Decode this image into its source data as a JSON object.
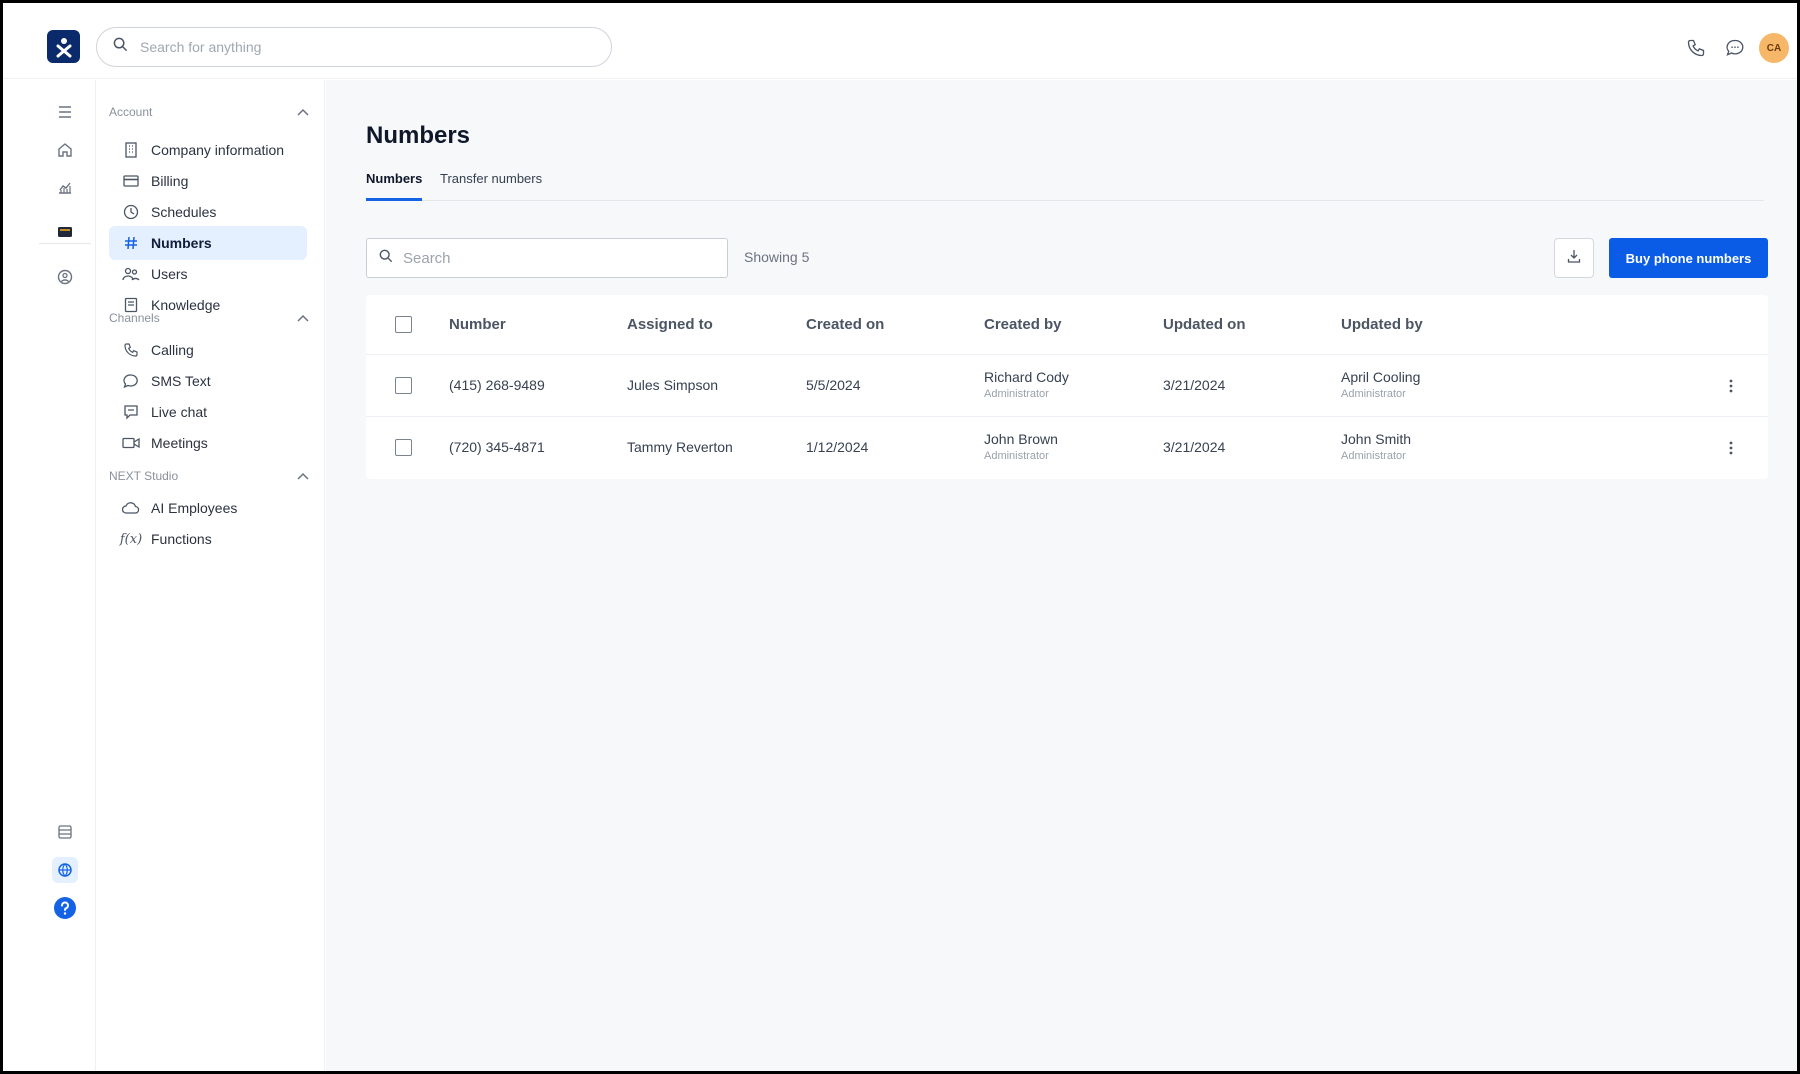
{
  "header": {
    "search_placeholder": "Search for anything",
    "avatar_initials": "CA",
    "icons": [
      "logo-icon",
      "search-icon",
      "phone-icon",
      "chat-icon"
    ]
  },
  "rail": {
    "icons": [
      "menu-icon",
      "home-icon",
      "analytics-icon",
      "wallet-icon",
      "contacts-icon",
      "database-icon",
      "settings-globe-icon",
      "help-icon"
    ]
  },
  "sidebar": {
    "sections": [
      {
        "title": "Account",
        "items": [
          {
            "label": "Company information",
            "icon": "building-icon"
          },
          {
            "label": "Billing",
            "icon": "credit-card-icon"
          },
          {
            "label": "Schedules",
            "icon": "clock-icon"
          },
          {
            "label": "Numbers",
            "icon": "hash-icon",
            "active": true
          },
          {
            "label": "Users",
            "icon": "users-icon"
          },
          {
            "label": "Knowledge",
            "icon": "book-icon"
          }
        ]
      },
      {
        "title": "Channels",
        "items": [
          {
            "label": "Calling",
            "icon": "phone-icon"
          },
          {
            "label": "SMS Text",
            "icon": "sms-icon"
          },
          {
            "label": "Live chat",
            "icon": "live-chat-icon"
          },
          {
            "label": "Meetings",
            "icon": "video-icon"
          }
        ]
      },
      {
        "title": "NEXT Studio",
        "items": [
          {
            "label": "AI Employees",
            "icon": "ai-cloud-icon"
          },
          {
            "label": "Functions",
            "icon": "function-icon"
          }
        ]
      }
    ]
  },
  "main": {
    "title": "Numbers",
    "tabs": [
      {
        "label": "Numbers",
        "active": true
      },
      {
        "label": "Transfer numbers",
        "active": false
      }
    ],
    "search_placeholder": "Search",
    "showing": "Showing 5",
    "buy_button": "Buy phone numbers",
    "accent_color": "#0a5ce6",
    "table": {
      "columns": [
        "Number",
        "Assigned to",
        "Created on",
        "Created by",
        "Updated on",
        "Updated by"
      ],
      "rows": [
        {
          "number": "(415) 268-9489",
          "assigned_to": "Jules Simpson",
          "created_on": "5/5/2024",
          "created_by": {
            "name": "Richard Cody",
            "role": "Administrator"
          },
          "updated_on": "3/21/2024",
          "updated_by": {
            "name": "April Cooling",
            "role": "Administrator"
          }
        },
        {
          "number": "(720) 345-4871",
          "assigned_to": "Tammy Reverton",
          "created_on": "1/12/2024",
          "created_by": {
            "name": "John Brown",
            "role": "Administrator"
          },
          "updated_on": "3/21/2024",
          "updated_by": {
            "name": "John Smith",
            "role": "Administrator"
          }
        }
      ]
    }
  }
}
